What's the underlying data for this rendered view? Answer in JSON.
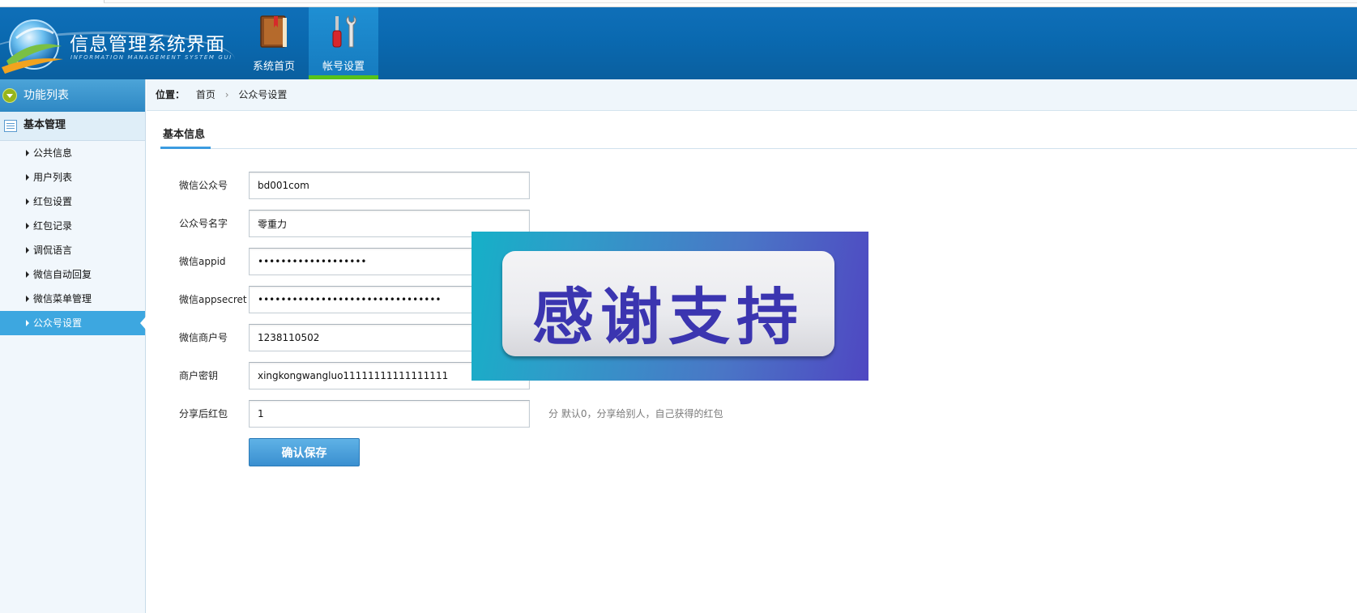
{
  "header": {
    "title": "信息管理系统界面",
    "subtitle": "INFORMATION MANAGEMENT SYSTEM GUI",
    "nav": [
      {
        "label": "系统首页",
        "icon": "book-icon"
      },
      {
        "label": "帐号设置",
        "icon": "tools-icon",
        "active": true
      }
    ]
  },
  "sidebar": {
    "header": "功能列表",
    "section": "基本管理",
    "items": [
      {
        "label": "公共信息"
      },
      {
        "label": "用户列表"
      },
      {
        "label": "红包设置"
      },
      {
        "label": "红包记录"
      },
      {
        "label": "调侃语言"
      },
      {
        "label": "微信自动回复"
      },
      {
        "label": "微信菜单管理"
      },
      {
        "label": "公众号设置",
        "active": true
      }
    ]
  },
  "breadcrumb": {
    "position_label": "位置：",
    "home": "首页",
    "current": "公众号设置"
  },
  "tab": {
    "label": "基本信息"
  },
  "form": {
    "fields": [
      {
        "label": "微信公众号",
        "value": "bd001com"
      },
      {
        "label": "公众号名字",
        "value": "零重力"
      },
      {
        "label": "微信appid",
        "value": "•••••••••••••••••••"
      },
      {
        "label": "微信appsecret",
        "value": "••••••••••••••••••••••••••••••••"
      },
      {
        "label": "微信商户号",
        "value": "1238110502"
      },
      {
        "label": "商户密钥",
        "value": "xingkongwangluo11111111111111111"
      },
      {
        "label": "分享后红包",
        "value": "1",
        "hint": "分 默认0，分享给别人，自己获得的红包"
      }
    ],
    "submit_label": "确认保存"
  },
  "overlay": {
    "text": "感谢支持"
  },
  "colors": {
    "header_bg": "#0a69b0",
    "active_nav_underline": "#56c21a",
    "sidebar_active": "#3da7e0",
    "button": "#3a8fd0",
    "overlay_text": "#3b35b0"
  }
}
